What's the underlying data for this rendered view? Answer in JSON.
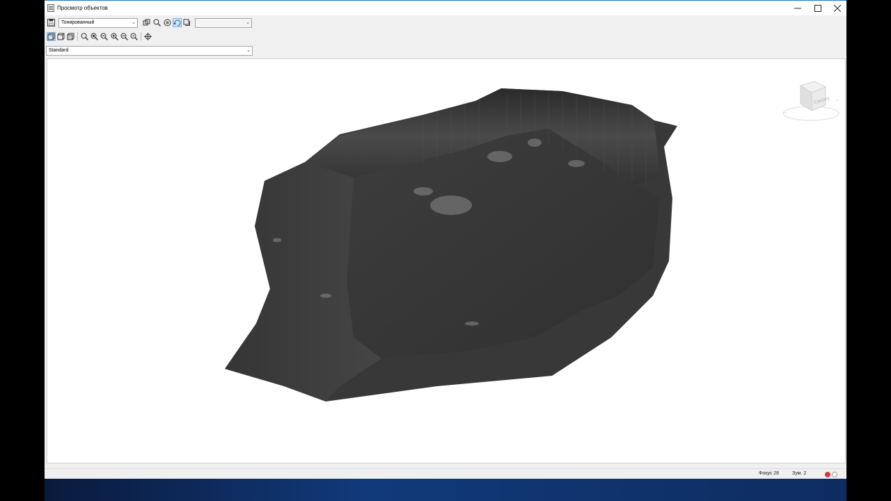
{
  "window": {
    "title": "Просмотр объектов"
  },
  "toolbar": {
    "save_icon": "save-icon",
    "visual_style": "Тонированный",
    "second_dropdown_value": "",
    "view_preset": "Standard"
  },
  "viewcube": {
    "face_label": "Сверху"
  },
  "status": {
    "focus": "Фокус 28",
    "zoom": "Зум. 2"
  },
  "colors": {
    "model": "#3a3a3a",
    "accent": "#2b78d0",
    "status_red": "#d23b3b"
  }
}
